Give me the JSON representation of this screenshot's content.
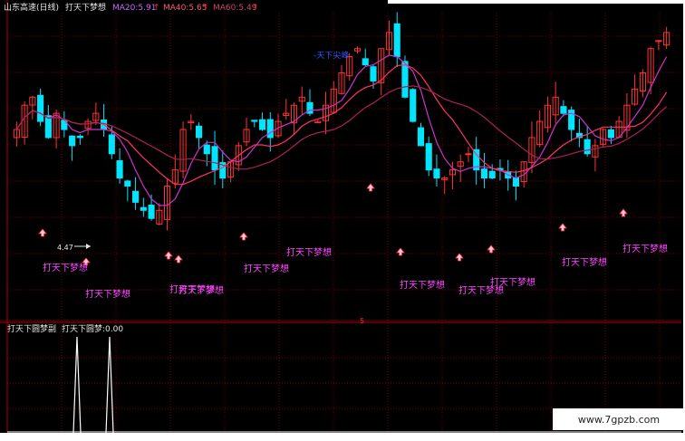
{
  "header": {
    "stock": "山东高速(日线)",
    "indicator": "打天下梦想",
    "ma20": "MA20:5.91",
    "ma40": "MA40:5.65",
    "ma60": "MA60:5.49",
    "arrow": "↑"
  },
  "sub_header": {
    "name": "打天下圆梦副",
    "value_label": "打天下圆梦:0.00"
  },
  "labels": {
    "signal": "打天下梦想",
    "top_label": "-天下尖峰",
    "low_price": "4.47",
    "panel_marker": "5"
  },
  "watermark": "www.7gpzb.com",
  "colors": {
    "up": "#ff3333",
    "down": "#00e5ff",
    "ma20": "#cc33cc",
    "ma40": "#ff3366",
    "ma60": "#aa2255",
    "signal": "#ff44ff",
    "grid": "#7a0000"
  },
  "chart_data": [
    {
      "type": "candlestick",
      "title": "山东高速(日线)",
      "series": [
        {
          "name": "MA20",
          "last": 5.91
        },
        {
          "name": "MA40",
          "last": 5.65
        },
        {
          "name": "MA60",
          "last": 5.49
        }
      ],
      "close_approx": [
        5.6,
        5.9,
        6.0,
        5.7,
        5.5,
        5.8,
        5.6,
        5.4,
        5.5,
        5.7,
        5.8,
        5.6,
        5.3,
        5.0,
        4.9,
        4.7,
        4.6,
        4.5,
        4.6,
        4.9,
        5.1,
        5.6,
        5.7,
        5.5,
        5.3,
        5.1,
        5.0,
        5.2,
        5.4,
        5.6,
        5.7,
        5.6,
        5.5,
        5.7,
        5.8,
        5.9,
        6.0,
        5.8,
        5.7,
        5.9,
        6.1,
        6.3,
        6.5,
        6.6,
        6.4,
        6.2,
        6.6,
        6.8,
        6.5,
        6.0,
        5.7,
        5.4,
        5.1,
        5.0,
        5.0,
        5.1,
        5.2,
        5.3,
        5.1,
        5.0,
        5.0,
        5.1,
        5.0,
        4.9,
        5.2,
        5.5,
        5.7,
        5.9,
        6.0,
        5.8,
        5.6,
        5.5,
        5.3,
        5.4,
        5.6,
        5.5,
        5.7,
        5.9,
        6.1,
        6.3,
        6.6,
        6.7,
        6.8
      ],
      "annotations": [
        "4.47",
        "-天下尖峰"
      ],
      "signals": 12
    },
    {
      "type": "line",
      "title": "打天下圆梦副",
      "series": [
        {
          "name": "打天下圆梦",
          "last": 0.0
        }
      ],
      "spikes_at_index": [
        14,
        18
      ],
      "ylim": [
        0,
        1
      ]
    }
  ]
}
